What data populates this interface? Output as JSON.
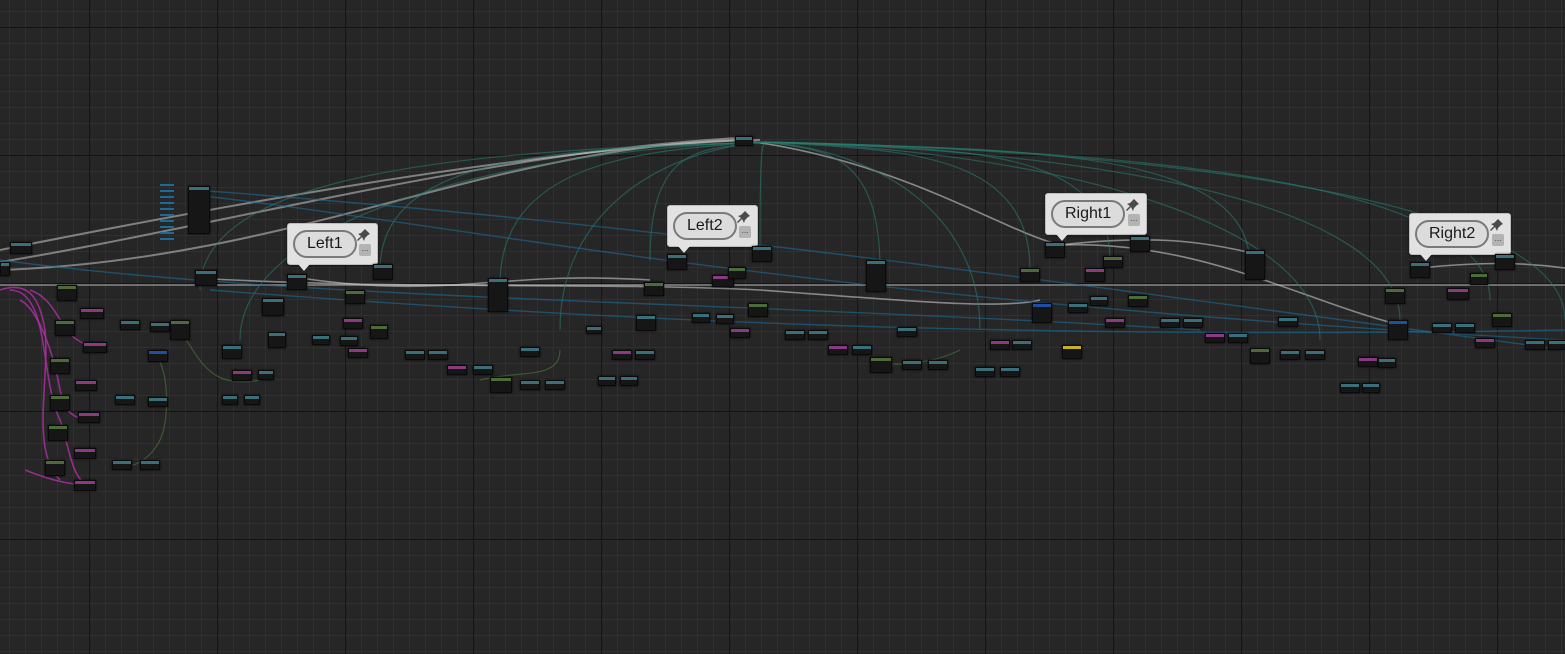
{
  "editor": {
    "type": "blueprint-graph",
    "background_color": "#262626",
    "grid": true
  },
  "comments": [
    {
      "label": "Left1"
    },
    {
      "label": "Left2"
    },
    {
      "label": "Right1"
    },
    {
      "label": "Right2"
    }
  ],
  "colors": {
    "exec_wire": "#c8c8c8",
    "wire_teal": "#2a7f73",
    "wire_blue": "#1d6a96",
    "wire_magenta": "#b030a8",
    "wire_green": "#4f7a3c",
    "node_body": "#161616",
    "node_header_teal": "#3a6f7a",
    "node_header_green": "#4d6a3a",
    "node_header_magenta": "#8a3a80",
    "node_header_blue": "#1f4fa0",
    "node_header_yellow": "#c8b020"
  },
  "icons": {
    "pin": "pin-icon",
    "details": "details-icon"
  }
}
